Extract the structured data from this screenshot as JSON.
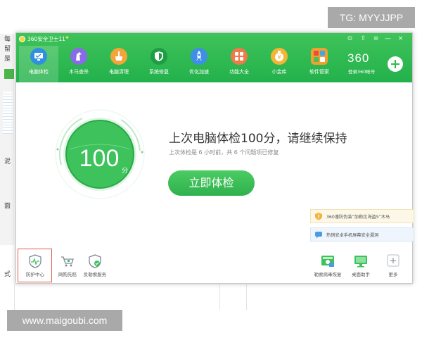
{
  "app": {
    "title": "360安全卫士11",
    "title_badge": "✦",
    "window_controls": [
      "⊙",
      "⇧",
      "≡",
      "—",
      "×"
    ]
  },
  "nav": {
    "items": [
      {
        "label": "电脑体检",
        "icon": "monitor-check-icon",
        "color": "#2f8fe0",
        "active": true
      },
      {
        "label": "木马查杀",
        "icon": "horse-icon",
        "color": "#8a6ae8",
        "active": false
      },
      {
        "label": "电脑清理",
        "icon": "broom-icon",
        "color": "#f3a53a",
        "active": false
      },
      {
        "label": "系统修复",
        "icon": "shield-icon",
        "color": "#20a84a",
        "active": false
      },
      {
        "label": "优化加速",
        "icon": "rocket-icon",
        "color": "#3f8ee8",
        "active": false
      },
      {
        "label": "功能大全",
        "icon": "grid-icon",
        "color": "#f07a4a",
        "active": false
      },
      {
        "label": "小金库",
        "icon": "coin-icon",
        "color": "#f5b534",
        "active": false
      },
      {
        "label": "软件管家",
        "icon": "apps-icon",
        "color": "#f0a030",
        "active": false
      }
    ]
  },
  "account": {
    "brand": "360",
    "login_label": "登录360帐号"
  },
  "score": {
    "value": "100",
    "unit": "分"
  },
  "status": {
    "headline": "上次电脑体检100分，请继续保持",
    "subtext": "上次体检是 6 小时前，共 6 个问题项已修复",
    "check_button": "立即体检"
  },
  "news": [
    {
      "text": "360谨防伪装“加勒比海盗5”木马",
      "icon": "warning-shield-icon"
    },
    {
      "text": "热销安卓手机屏幕安全漏洞",
      "icon": "chat-icon"
    }
  ],
  "bottom_left": [
    {
      "label": "防护中心",
      "icon": "pulse-shield-icon",
      "highlighted": true
    },
    {
      "label": "网购先赔",
      "icon": "cart-icon",
      "highlighted": false
    },
    {
      "label": "反勒索服务",
      "icon": "shield-check-icon",
      "highlighted": false
    }
  ],
  "bottom_right": [
    {
      "label": "勒索病毒恢复",
      "icon": "recovery-icon"
    },
    {
      "label": "桌面助手",
      "icon": "desktop-icon"
    },
    {
      "label": "更多",
      "icon": "plus-box-icon"
    }
  ],
  "background": {
    "fragments": [
      "每",
      "留",
      "是",
      "泥",
      "面",
      "式"
    ]
  },
  "watermarks": {
    "tg": "TG: MYYJJPP",
    "site": "www.maigoubi.com"
  },
  "colors": {
    "brand_green": "#2fb94f",
    "highlight_red": "#e05a50"
  }
}
